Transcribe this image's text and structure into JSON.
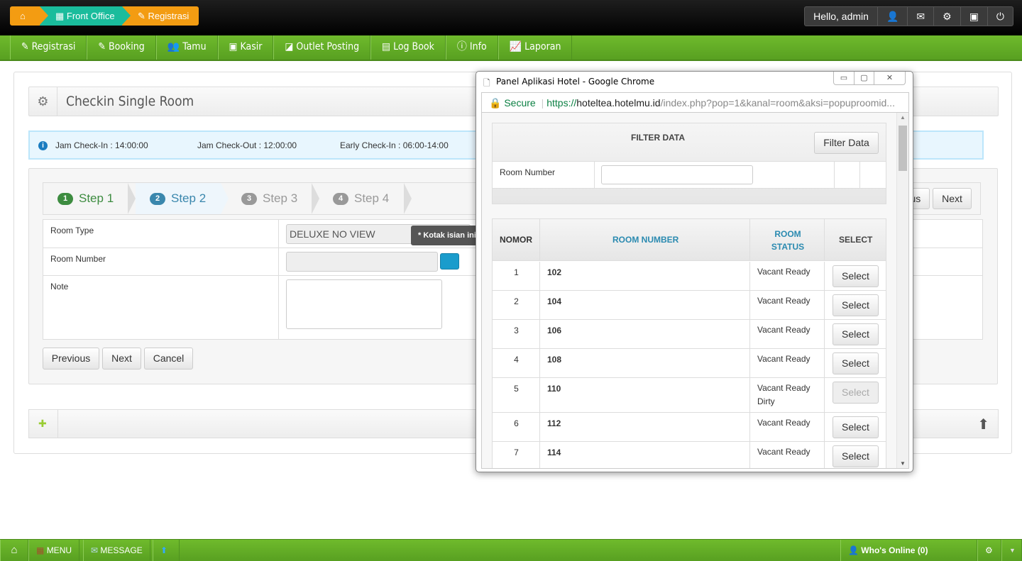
{
  "breadcrumb": {
    "home_icon": "home-icon",
    "items": [
      {
        "label": "Front Office",
        "icon": "calendar-icon",
        "color": "#1abc9c"
      },
      {
        "label": "Registrasi",
        "icon": "edit-icon",
        "color": "#f39c12"
      }
    ]
  },
  "user": {
    "greeting": "Hello, admin",
    "icons": [
      "user-icon",
      "envelope-icon",
      "gear-icon",
      "briefcase-icon",
      "power-icon"
    ]
  },
  "menu": [
    {
      "label": "Registrasi",
      "icon": "✎"
    },
    {
      "label": "Booking",
      "icon": "✎"
    },
    {
      "label": "Tamu",
      "icon": "👥"
    },
    {
      "label": "Kasir",
      "icon": "▣"
    },
    {
      "label": "Outlet Posting",
      "icon": "◪"
    },
    {
      "label": "Log Book",
      "icon": "▤"
    },
    {
      "label": "Info",
      "icon": "ⓘ"
    },
    {
      "label": "Laporan",
      "icon": "📈"
    }
  ],
  "page": {
    "title": "Checkin Single Room",
    "info": {
      "checkin": "Jam Check-In : 14:00:00",
      "checkout": "Jam Check-Out : 12:00:00",
      "early": "Early Check-In : 06:00-14:00"
    },
    "steps": [
      {
        "n": "1",
        "label": "Step 1"
      },
      {
        "n": "2",
        "label": "Step 2"
      },
      {
        "n": "3",
        "label": "Step 3"
      },
      {
        "n": "4",
        "label": "Step 4"
      }
    ],
    "form": {
      "room_type_label": "Room Type",
      "room_type_value": "DELUXE NO VIEW",
      "room_number_label": "Room Number",
      "note_label": "Note",
      "tooltip": "* Kotak isian ini harus diisi"
    },
    "buttons": {
      "previous": "Previous",
      "next": "Next",
      "cancel": "Cancel"
    }
  },
  "popup": {
    "title": "Panel Aplikasi Hotel - Google Chrome",
    "secure": "Secure",
    "url_scheme": "https://",
    "url_host": "hoteltea.hotelmu.id",
    "url_path": "/index.php?pop=1&kanal=room&aksi=popuproomid...",
    "filter": {
      "header": "FILTER DATA",
      "button": "Filter Data",
      "room_number_label": "Room Number",
      "room_number_value": ""
    },
    "columns": [
      "NOMOR",
      "ROOM NUMBER",
      "ROOM STATUS",
      "SELECT"
    ],
    "rows": [
      {
        "no": "1",
        "room": "102",
        "status": "Vacant Ready",
        "select": "Select",
        "enabled": true
      },
      {
        "no": "2",
        "room": "104",
        "status": "Vacant Ready",
        "select": "Select",
        "enabled": true
      },
      {
        "no": "3",
        "room": "106",
        "status": "Vacant Ready",
        "select": "Select",
        "enabled": true
      },
      {
        "no": "4",
        "room": "108",
        "status": "Vacant Ready",
        "select": "Select",
        "enabled": true
      },
      {
        "no": "5",
        "room": "110",
        "status": "Vacant Ready Dirty",
        "select": "Select",
        "enabled": false
      },
      {
        "no": "6",
        "room": "112",
        "status": "Vacant Ready",
        "select": "Select",
        "enabled": true
      },
      {
        "no": "7",
        "room": "114",
        "status": "Vacant Ready",
        "select": "Select",
        "enabled": true
      }
    ]
  },
  "bottombar": {
    "menu": "MENU",
    "message": "MESSAGE",
    "online": "Who's Online (0)"
  }
}
